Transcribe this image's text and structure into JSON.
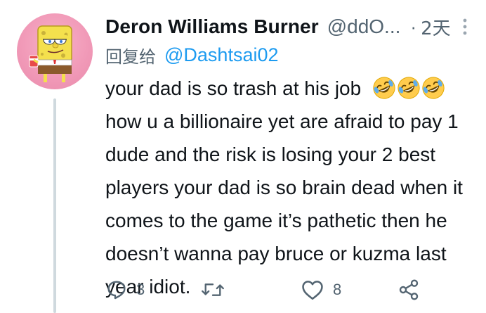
{
  "tweet": {
    "display_name": "Deron Williams Burner",
    "handle": "@ddO...",
    "separator": "·",
    "time": "2天",
    "reply_prefix": "回复给",
    "reply_to": "@Dashtsai02",
    "lines": [
      "your dad is so trash at his job",
      "how u a billionaire yet are afraid to pay 1",
      "dude and the risk is losing your 2 best",
      "players your dad is so brain dead when it",
      "comes to the game it’s pathetic then he",
      "doesn’t wanna pay bruce or kuzma last",
      "year idiot."
    ],
    "emojis": [
      "rofl-emoji",
      "rofl-emoji",
      "rofl-emoji"
    ],
    "actions": {
      "reply_count": "3",
      "retweet_count": "",
      "like_count": "8"
    },
    "colors": {
      "text": "#0f1419",
      "secondary": "#536471",
      "link": "#1d9bf0",
      "thread_line": "#cfd9de",
      "avatar_bg": "#f19ab8"
    },
    "icons": {
      "more": "more-vertical-icon",
      "reply": "reply-icon",
      "retweet": "retweet-icon",
      "like": "heart-icon",
      "share": "share-icon"
    }
  }
}
